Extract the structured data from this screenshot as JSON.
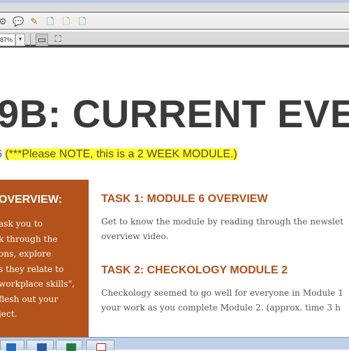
{
  "toolbar": {
    "zoom_value": "87%",
    "icons": [
      "gear-icon",
      "comment-icon",
      "highlight-icon",
      "file-icon",
      "file-export-icon",
      "file-download-icon"
    ]
  },
  "document": {
    "title": "9B: CURRENT EVE",
    "subtitle_prefix": "6 ",
    "subtitle_note": "(***Please NOTE, this is a 2 WEEK MODULE.)",
    "overview": {
      "heading": "OVERVIEW:",
      "lines": [
        "ask you to",
        "k through the",
        "ons, explore",
        "s they relate to",
        "workplace skills\",",
        "flesh out your",
        "ject."
      ]
    },
    "tasks": [
      {
        "title": "TASK 1: MODULE 6 OVERVIEW",
        "lines": [
          "Get to know the module by reading through the newslet",
          "overview video."
        ]
      },
      {
        "title": "TASK 2: CHECKOLOGY MODULE 2",
        "lines": [
          "Checkology seemed to go well for everyone in Module 1",
          "your work as you complete Module 2.  (approx. time 3 h"
        ]
      }
    ],
    "accent_color": "#b3521a",
    "highlight_color": "#ffff33"
  },
  "taskbar": {
    "apps": [
      "outlook",
      "word",
      "excel",
      "acrobat"
    ]
  }
}
